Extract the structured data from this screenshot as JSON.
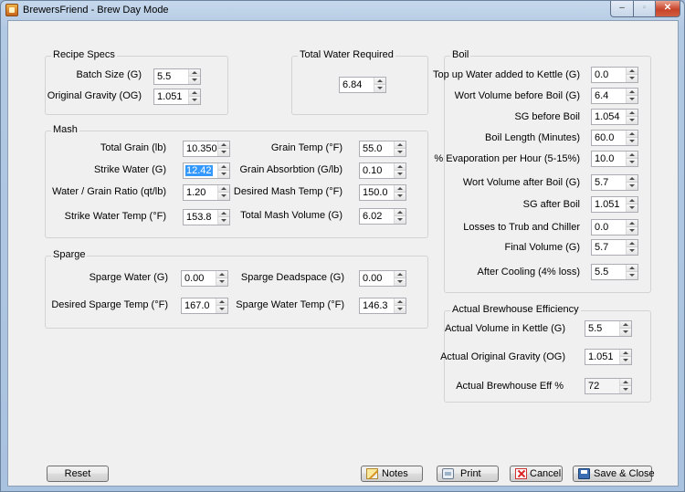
{
  "window": {
    "title": "BrewersFriend - Brew Day Mode",
    "controls": {
      "minimize": "–",
      "maximize": "▫",
      "close": "✕"
    }
  },
  "recipe_specs": {
    "title": "Recipe Specs",
    "batch_size": {
      "label": "Batch Size (G)",
      "value": "5.5"
    },
    "original_gravity": {
      "label": "Original Gravity (OG)",
      "value": "1.051"
    }
  },
  "total_water": {
    "title": "Total Water Required",
    "value": "6.84"
  },
  "mash": {
    "title": "Mash",
    "total_grain": {
      "label": "Total Grain (lb)",
      "value": "10.350"
    },
    "strike_water": {
      "label": "Strike Water (G)",
      "value": "12.42"
    },
    "water_grain_ratio": {
      "label": "Water / Grain Ratio (qt/lb)",
      "value": "1.20"
    },
    "strike_water_temp": {
      "label": "Strike Water Temp (°F)",
      "value": "153.8"
    },
    "grain_temp": {
      "label": "Grain Temp (°F)",
      "value": "55.0"
    },
    "grain_absorption": {
      "label": "Grain Absorbtion (G/lb)",
      "value": "0.10"
    },
    "desired_mash_temp": {
      "label": "Desired Mash Temp (°F)",
      "value": "150.0"
    },
    "total_mash_volume": {
      "label": "Total Mash Volume (G)",
      "value": "6.02"
    }
  },
  "sparge": {
    "title": "Sparge",
    "sparge_water": {
      "label": "Sparge Water (G)",
      "value": "0.00"
    },
    "desired_sparge_temp": {
      "label": "Desired Sparge Temp (°F)",
      "value": "167.0"
    },
    "sparge_deadspace": {
      "label": "Sparge Deadspace (G)",
      "value": "0.00"
    },
    "sparge_water_temp": {
      "label": "Sparge Water Temp (°F)",
      "value": "146.3"
    }
  },
  "boil": {
    "title": "Boil",
    "top_up_water": {
      "label": "Top up Water added to Kettle (G)",
      "value": "0.0"
    },
    "wort_before_boil": {
      "label": "Wort Volume before Boil (G)",
      "value": "6.4"
    },
    "sg_before_boil": {
      "label": "SG before Boil",
      "value": "1.054"
    },
    "boil_length": {
      "label": "Boil Length (Minutes)",
      "value": "60.0"
    },
    "evaporation": {
      "label": "% Evaporation per Hour (5-15%)",
      "value": "10.0"
    },
    "wort_after_boil": {
      "label": "Wort Volume after Boil (G)",
      "value": "5.7"
    },
    "sg_after_boil": {
      "label": "SG after Boil",
      "value": "1.051"
    },
    "losses": {
      "label": "Losses to Trub and Chiller",
      "value": "0.0"
    },
    "final_volume": {
      "label": "Final Volume (G)",
      "value": "5.7"
    },
    "after_cooling": {
      "label": "After Cooling (4% loss)",
      "value": "5.5"
    }
  },
  "efficiency": {
    "title": "Actual Brewhouse Efficiency",
    "actual_volume": {
      "label": "Actual Volume in Kettle (G)",
      "value": "5.5"
    },
    "actual_og": {
      "label": "Actual Original Gravity (OG)",
      "value": "1.051"
    },
    "brewhouse_eff": {
      "label": "Actual Brewhouse Eff %",
      "value": "72"
    }
  },
  "buttons": {
    "reset": "Reset",
    "notes": "Notes",
    "print": "Print",
    "cancel": "Cancel",
    "save_close": "Save & Close"
  }
}
